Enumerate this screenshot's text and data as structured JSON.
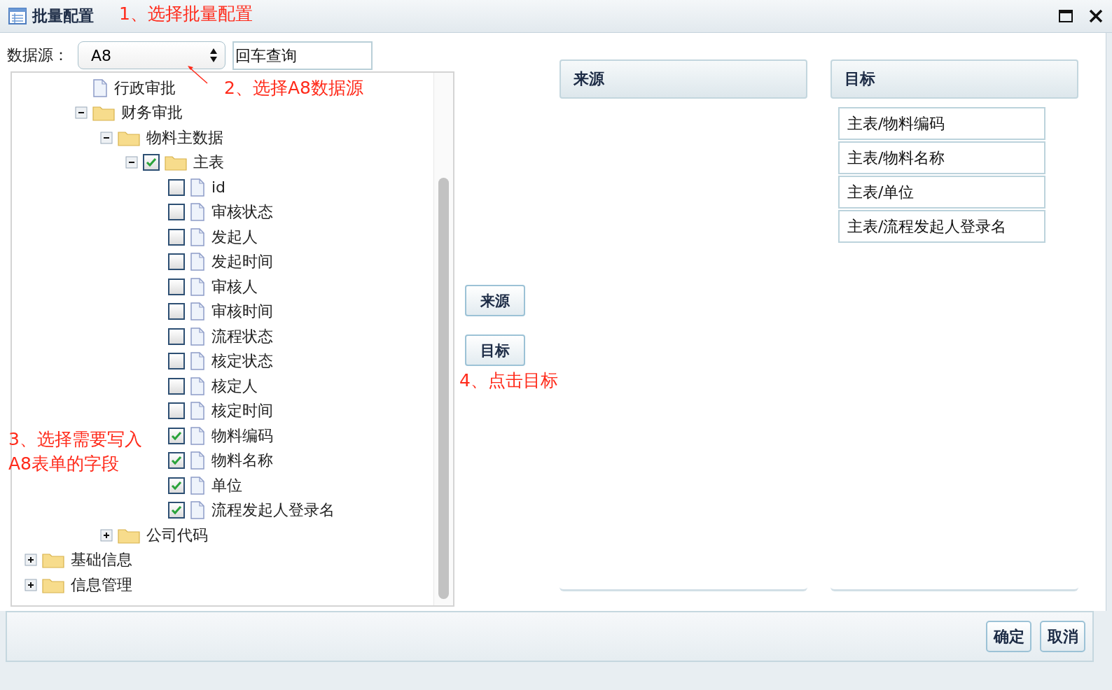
{
  "window": {
    "title": "批量配置"
  },
  "datasource": {
    "label": "数据源：",
    "value": "A8",
    "search_placeholder": "回车查询"
  },
  "tree": {
    "items": [
      {
        "children": [
          {
            "children": [
              {
                "kind": "file",
                "label": "行政审批"
              },
              {
                "kind": "folder",
                "label": "财务审批",
                "expanded": true,
                "children": [
                  {
                    "kind": "folder",
                    "label": "物料主数据",
                    "expanded": true,
                    "children": [
                      {
                        "kind": "folder",
                        "label": "主表",
                        "expanded": true,
                        "checked": true,
                        "children": [
                          {
                            "kind": "file",
                            "label": "id",
                            "checked": false
                          },
                          {
                            "kind": "file",
                            "label": "审核状态",
                            "checked": false
                          },
                          {
                            "kind": "file",
                            "label": "发起人",
                            "checked": false
                          },
                          {
                            "kind": "file",
                            "label": "发起时间",
                            "checked": false
                          },
                          {
                            "kind": "file",
                            "label": "审核人",
                            "checked": false
                          },
                          {
                            "kind": "file",
                            "label": "审核时间",
                            "checked": false
                          },
                          {
                            "kind": "file",
                            "label": "流程状态",
                            "checked": false
                          },
                          {
                            "kind": "file",
                            "label": "核定状态",
                            "checked": false
                          },
                          {
                            "kind": "file",
                            "label": "核定人",
                            "checked": false
                          },
                          {
                            "kind": "file",
                            "label": "核定时间",
                            "checked": false
                          },
                          {
                            "kind": "file",
                            "label": "物料编码",
                            "checked": true
                          },
                          {
                            "kind": "file",
                            "label": "物料名称",
                            "checked": true
                          },
                          {
                            "kind": "file",
                            "label": "单位",
                            "checked": true
                          },
                          {
                            "kind": "file",
                            "label": "流程发起人登录名",
                            "checked": true
                          }
                        ]
                      }
                    ]
                  },
                  {
                    "kind": "folder",
                    "label": "公司代码",
                    "expanded": false
                  }
                ]
              }
            ]
          }
        ]
      },
      {
        "kind": "folder",
        "label": "基础信息",
        "expanded": false
      },
      {
        "kind": "folder",
        "label": "信息管理",
        "expanded": false
      }
    ]
  },
  "mapping_buttons": [
    "来源",
    "目标"
  ],
  "source_panel": {
    "title": "来源"
  },
  "target_panel": {
    "title": "目标",
    "items": [
      "主表/物料编码",
      "主表/物料名称",
      "主表/单位",
      "主表/流程发起人登录名"
    ]
  },
  "footer_buttons": [
    "确定",
    "取消"
  ],
  "annotations": [
    "1、选择批量配置",
    "2、选择A8数据源",
    "3、选择需要写入\nA8表单的字段",
    "4、点击目标"
  ]
}
